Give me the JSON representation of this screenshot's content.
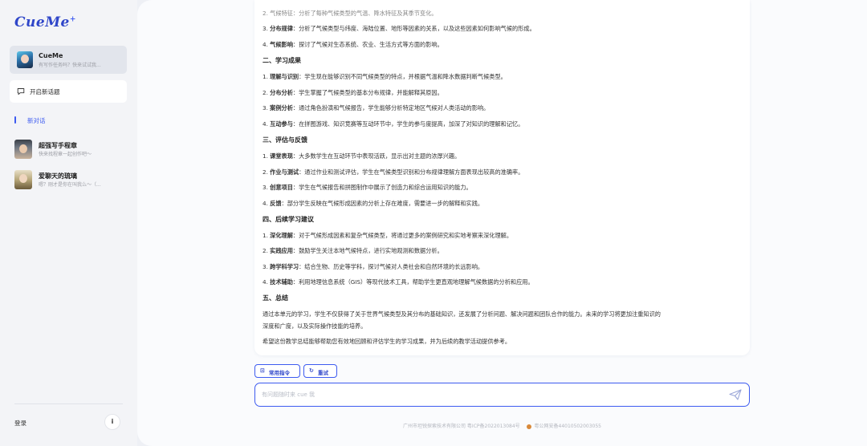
{
  "sidebar": {
    "logo": "CueMe",
    "logo_mark": "+",
    "agent": {
      "name": "CueMe",
      "subtitle": "有写作任务吗？快来试试我..."
    },
    "new_topic_label": "开启新话题",
    "new_chat_label": "新对话",
    "chats": [
      {
        "title": "超强写手程章",
        "subtitle": "快来找程章一起创作吧～"
      },
      {
        "title": "爱聊天的琉璃",
        "subtitle": "嗯？刚才是你在叫我么～（..."
      }
    ],
    "login_label": "登录",
    "info_label": "i"
  },
  "content": {
    "lines": [
      {
        "type": "text",
        "text": "2. 气候特征：分析了每种气候类型的气温、降水特征及其季节变化。"
      },
      {
        "type": "item",
        "num": "3.",
        "bold": "分布规律",
        "text": "：分析了气候类型与纬度、海陆位置、地形等因素的关系，以及这些因素如何影响气候的形成。"
      },
      {
        "type": "item",
        "num": "4.",
        "bold": "气候影响",
        "text": "：探讨了气候对生态系统、农业、生活方式等方面的影响。"
      },
      {
        "type": "heading",
        "text": "二、学习成果"
      },
      {
        "type": "item",
        "num": "1.",
        "bold": "理解与识别",
        "text": "：学生现在能够识别不同气候类型的特点，并根据气温和降水数据判断气候类型。"
      },
      {
        "type": "item",
        "num": "2.",
        "bold": "分布分析",
        "text": "：学生掌握了气候类型的基本分布规律，并能解释其原因。"
      },
      {
        "type": "item",
        "num": "3.",
        "bold": "案例分析",
        "text": "：通过角色扮演和气候报告，学生能够分析特定地区气候对人类活动的影响。"
      },
      {
        "type": "item",
        "num": "4.",
        "bold": "互动参与",
        "text": "：在拼图游戏、知识竞赛等互动环节中，学生的参与度提高，加深了对知识的理解和记忆。"
      },
      {
        "type": "heading",
        "text": "三、评估与反馈"
      },
      {
        "type": "item",
        "num": "1.",
        "bold": "课堂表现",
        "text": "：大多数学生在互动环节中表现活跃，显示出对主题的浓厚兴趣。"
      },
      {
        "type": "item",
        "num": "2.",
        "bold": "作业与测试",
        "text": "：通过作业和测试评估，学生在气候类型识别和分布规律理解方面表现出较高的准确率。"
      },
      {
        "type": "item",
        "num": "3.",
        "bold": "创意项目",
        "text": "：学生在气候报告和拼图制作中展示了创造力和综合运用知识的能力。"
      },
      {
        "type": "item",
        "num": "4.",
        "bold": "反馈",
        "text": "：部分学生反映在气候形成因素的分析上存在难度，需要进一步的解释和实践。"
      },
      {
        "type": "heading",
        "text": "四、后续学习建议"
      },
      {
        "type": "item",
        "num": "1.",
        "bold": "深化理解",
        "text": "：对于气候形成因素和复杂气候类型，将通过更多的案例研究和实地考察来深化理解。"
      },
      {
        "type": "item",
        "num": "2.",
        "bold": "实践应用",
        "text": "：鼓励学生关注本地气候特点，进行实地观测和数据分析。"
      },
      {
        "type": "item",
        "num": "3.",
        "bold": "跨学科学习",
        "text": "：结合生物、历史等学科，探讨气候对人类社会和自然环境的长远影响。"
      },
      {
        "type": "item",
        "num": "4.",
        "bold": "技术辅助",
        "text": "：利用地理信息系统（GIS）等现代技术工具，帮助学生更直观地理解气候数据的分析和应用。"
      },
      {
        "type": "heading",
        "text": "五、总结"
      },
      {
        "type": "text",
        "text": "通过本单元的学习，学生不仅获得了关于世界气候类型及其分布的基础知识，还发展了分析问题、解决问题和团队合作的能力。未来的学习将更加注重知识的"
      },
      {
        "type": "text",
        "text": "深度和广度，以及实际操作技能的培养。"
      },
      {
        "type": "text",
        "text": "希望这份教学总结能够帮助您有效地回顾和评估学生的学习成果，并为后续的教学活动提供参考。"
      }
    ]
  },
  "toolbar": {
    "common_commands_label": "常用指令",
    "retry_label": "重试"
  },
  "input": {
    "placeholder": "有问题随时来 cue 我"
  },
  "footer": {
    "company": "广州市坦锐探索技术有限公司 粤ICP备2022013084号",
    "police": "粤公网安备44010502003055"
  },
  "colors": {
    "accent": "#3d5bf0",
    "sidebar_bg": "#f3f4f7",
    "page_bg": "#fafbfd"
  }
}
